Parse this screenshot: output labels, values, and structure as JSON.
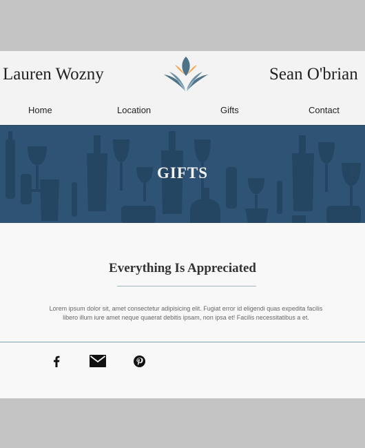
{
  "header": {
    "name_left": "Lauren Wozny",
    "name_right": "Sean O'brian",
    "logo_icon": "floral-fan-logo-icon"
  },
  "nav": {
    "items": [
      {
        "label": "Home"
      },
      {
        "label": "Location"
      },
      {
        "label": "Gifts"
      },
      {
        "label": "Contact"
      }
    ]
  },
  "banner": {
    "title": "GIFTS",
    "background_icon": "wine-bottles-glasses-pattern"
  },
  "main": {
    "heading": "Everything Is Appreciated",
    "body": "Lorem ipsum dolor sit, amet consectetur adipisicing elit. Fugiat error id eligendi quas expedita facilis libero illum iure amet neque quaerat debitis ipsam, non ipsa et! Facilis necessitatibus a et."
  },
  "social": {
    "links": [
      {
        "icon": "facebook-icon"
      },
      {
        "icon": "email-icon"
      },
      {
        "icon": "pinterest-icon"
      }
    ]
  },
  "colors": {
    "banner": "#2f5375",
    "logo_blue": "#4e7389",
    "logo_orange": "#f0a85a",
    "accent_rule": "#7fa2b0"
  }
}
